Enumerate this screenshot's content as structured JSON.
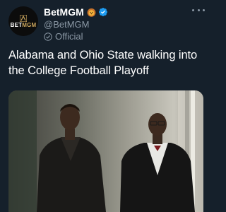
{
  "account": {
    "display_name": "BetMGM",
    "handle": "@BetMGM",
    "label": "Official",
    "avatar_text_bet": "BET",
    "avatar_text_mgm": "MGM"
  },
  "tweet": {
    "text": "Alabama and Ohio State walking into the College Football Playoff"
  },
  "colors": {
    "background": "#15202b",
    "verified": "#1d9bf0",
    "muted": "#8b98a5",
    "brand_gold": "#c9a45c"
  },
  "icons": {
    "emoji": "lion-face-icon",
    "verified": "verified-badge-icon",
    "official": "official-check-icon",
    "more": "more-options-icon"
  }
}
